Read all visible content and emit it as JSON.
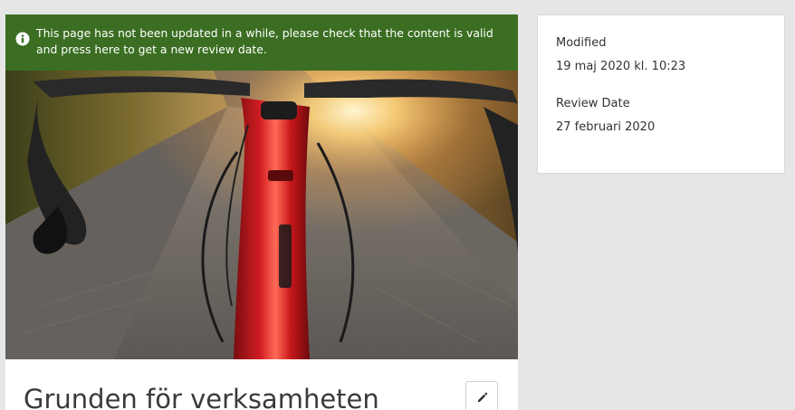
{
  "banner": {
    "message": "This page has not been updated in a while, please check that the content is valid and press here to get a new review date.",
    "icon": "info-circle-icon",
    "background_color": "#3b6e22"
  },
  "hero": {
    "subject": "road bicycle handlebars with sunlight"
  },
  "article": {
    "title": "Grunden för verksamheten",
    "edit_icon": "pencil-icon"
  },
  "meta": {
    "modified_label": "Modified",
    "modified_value": "19 maj 2020 kl. 10:23",
    "review_label": "Review Date",
    "review_value": "27 februari 2020"
  }
}
